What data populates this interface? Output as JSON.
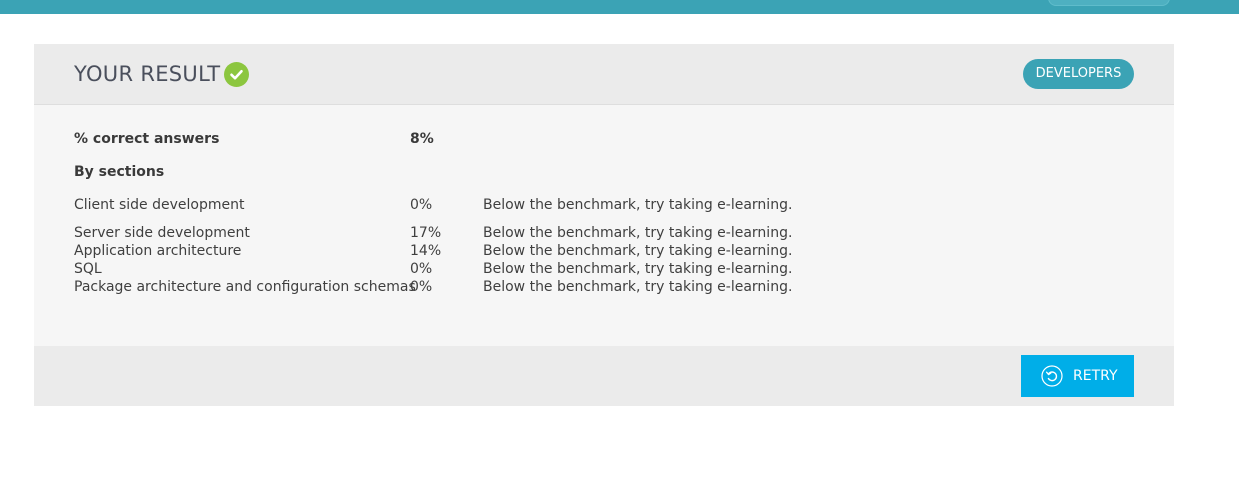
{
  "header": {
    "title": "YOUR RESULT",
    "badge": "DEVELOPERS"
  },
  "summary": {
    "label": "% correct answers",
    "value": "8%"
  },
  "sections_heading": "By sections",
  "sections": [
    {
      "name": "Client side development",
      "pct": "0%",
      "note": "Below the benchmark, try taking e-learning."
    },
    {
      "name": "Server side development",
      "pct": "17%",
      "note": "Below the benchmark, try taking e-learning."
    },
    {
      "name": "Application architecture",
      "pct": "14%",
      "note": "Below the benchmark, try taking e-learning."
    },
    {
      "name": "SQL",
      "pct": "0%",
      "note": "Below the benchmark, try taking e-learning."
    },
    {
      "name": "Package architecture and configuration schemas",
      "pct": "0%",
      "note": "Below the benchmark, try taking e-learning."
    }
  ],
  "footer": {
    "retry_label": "RETRY"
  },
  "icons": {
    "check": "check-circle-icon",
    "retry": "retry-icon"
  },
  "colors": {
    "top_bar": "#3ba3b5",
    "badge": "#3ba3b5",
    "check": "#8cc63f",
    "retry_button": "#00aee8"
  }
}
